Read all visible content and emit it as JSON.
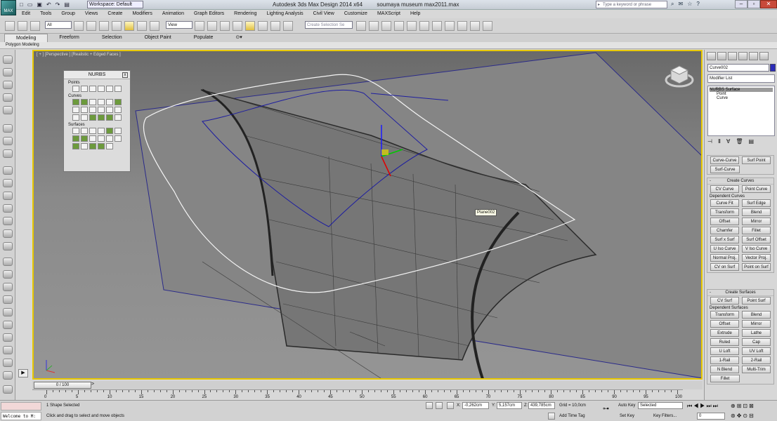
{
  "app": {
    "logo_text": "MAX",
    "workspace": "Workspace: Default",
    "title_app": "Autodesk 3ds Max Design 2014 x64",
    "title_file": "soumaya museum max2011.max",
    "search_placeholder": "Type a keyword or phrase"
  },
  "menu": [
    "Edit",
    "Tools",
    "Group",
    "Views",
    "Create",
    "Modifiers",
    "Animation",
    "Graph Editors",
    "Rendering",
    "Lighting Analysis",
    "Civil View",
    "Customize",
    "MAXScript",
    "Help"
  ],
  "toolbar": {
    "selection_filter": "All",
    "ref_coord": "View",
    "named_sel_placeholder": "Create Selection Se"
  },
  "ribbon": {
    "tabs": [
      "Modeling",
      "Freeform",
      "Selection",
      "Object Paint",
      "Populate"
    ],
    "active_tab": "Modeling",
    "sub": "Polygon Modeling"
  },
  "viewport": {
    "label": "[ + ] [Perspective ] [Realistic + Edged Faces ]",
    "tooltip": "Plane002"
  },
  "nurbs": {
    "title": "NURBS",
    "groups": [
      "Points",
      "Curves",
      "Surfaces"
    ]
  },
  "command_panel": {
    "object_name": "Curve002",
    "object_color": "#2b2bb8",
    "modifier_list": "Modifier List",
    "stack": [
      "NURBS Surface",
      "Point",
      "Curve"
    ],
    "top_buttons": [
      "Curve-Curve",
      "Surf Point",
      "Surf-Curve"
    ],
    "create_curves": {
      "title": "Create Curves",
      "primary": [
        "CV Curve",
        "Point Curve"
      ],
      "dependent_title": "Dependent Curves",
      "dependent": [
        "Curve Fit",
        "Surf Edge",
        "Transform",
        "Blend",
        "Offset",
        "Mirror",
        "Chamfer",
        "Fillet",
        "Surf x Surf",
        "Surf Offset",
        "U Iso Curve",
        "V Iso Curve",
        "Normal Proj.",
        "Vector Proj.",
        "CV on Surf",
        "Point on Surf"
      ]
    },
    "create_surfaces": {
      "title": "Create Surfaces",
      "primary": [
        "CV Surf",
        "Point Surf"
      ],
      "dependent_title": "Dependent Surfaces",
      "dependent": [
        "Transform",
        "Blend",
        "Offset",
        "Mirror",
        "Extrude",
        "Lathe",
        "Ruled",
        "Cap",
        "U Loft",
        "UV Loft",
        "1-Rail",
        "2-Rail",
        "N Blend",
        "Multi-Trim",
        "Fillet"
      ]
    }
  },
  "timeline": {
    "slider": "0 / 100",
    "ticks": [
      "0",
      "5",
      "10",
      "15",
      "20",
      "25",
      "30",
      "35",
      "40",
      "45",
      "50",
      "55",
      "60",
      "65",
      "70",
      "75",
      "80",
      "85",
      "90",
      "95",
      "100"
    ]
  },
  "status": {
    "welcome": "Welcome to M:",
    "selected": "1 Shape Selected",
    "prompt": "Click and drag to select and move objects",
    "x_label": "X:",
    "x": "-0,262cm",
    "y_label": "Y:",
    "y": "5,157cm",
    "z_label": "Z:",
    "z": "439,785cm",
    "grid": "Grid = 10,0cm",
    "add_time_tag": "Add Time Tag",
    "auto_key": "Auto Key",
    "key_mode": "Selected",
    "set_key": "Set Key",
    "key_filters": "Key Filters...",
    "frame": "0"
  }
}
